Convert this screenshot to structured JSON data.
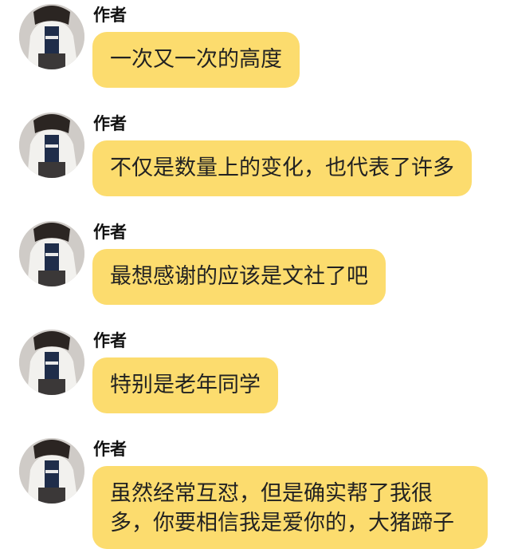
{
  "colors": {
    "bubble": "#fcdc6e",
    "text": "#222222",
    "sender": "#111111",
    "background": "#ffffff"
  },
  "messages": [
    {
      "sender": "作者",
      "text": "一次又一次的高度",
      "avatar_icon": "user-avatar"
    },
    {
      "sender": "作者",
      "text": "不仅是数量上的变化，也代表了许多",
      "avatar_icon": "user-avatar"
    },
    {
      "sender": "作者",
      "text": "最想感谢的应该是文社了吧",
      "avatar_icon": "user-avatar"
    },
    {
      "sender": "作者",
      "text": "特别是老年同学",
      "avatar_icon": "user-avatar"
    },
    {
      "sender": "作者",
      "text": "虽然经常互怼，但是确实帮了我很多，你要相信我是爱你的，大猪蹄子",
      "avatar_icon": "user-avatar"
    }
  ]
}
